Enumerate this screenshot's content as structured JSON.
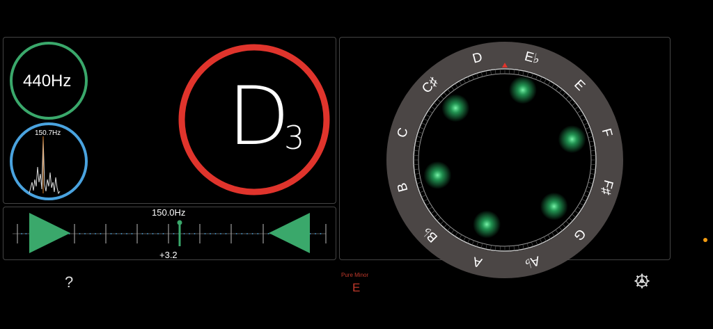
{
  "reference": {
    "label": "440Hz"
  },
  "spectrum": {
    "label": "150.7Hz"
  },
  "note": {
    "letter": "D",
    "octave": "3"
  },
  "meter": {
    "frequency": "150.0Hz",
    "cents": "+3.2",
    "needle_offset_cents": 3.2
  },
  "wheel": {
    "notes": [
      "C",
      "C♯",
      "D",
      "E♭",
      "E",
      "F",
      "F♯",
      "G",
      "A♭",
      "A",
      "B♭",
      "B"
    ]
  },
  "mode": {
    "label": "Pure Minor",
    "key": "E"
  },
  "toolbar": {
    "help_label": "?"
  },
  "colors": {
    "reference_ring": "#3aa86b",
    "spectrum_ring": "#4aa3df",
    "note_ring": "#e0342c",
    "marker": "#3aa86b",
    "glow": "#2ecc71",
    "pointer": "#e0342c",
    "accent": "#f39c12"
  },
  "icons": {
    "help": "question-mark-icon",
    "settings": "gear-icon"
  }
}
